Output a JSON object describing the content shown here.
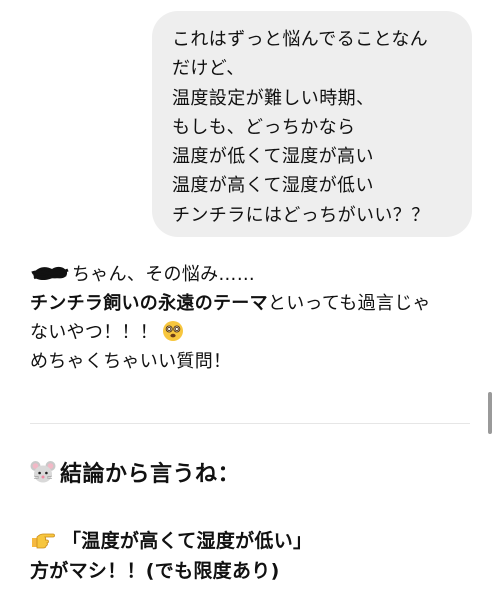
{
  "user_message": {
    "lines": [
      "これはずっと悩んでることなん",
      "だけど、",
      "温度設定が難しい時期、",
      "もしも、どっちかなら",
      "温度が低くて湿度が高い",
      "温度が高くて湿度が低い",
      "チンチラにはどっちがいい？？"
    ]
  },
  "reply": {
    "greeting": "ちゃん、その悩み……",
    "emphasis": "チンチラ飼いの永遠のテーマ",
    "line2_rest": "といっても過言じゃ",
    "line3": "ないやつ！！！",
    "line4": "めちゃくちゃいい質問！",
    "emoji_icon": "dizzy-face-emoji",
    "redacted_icon": "redacted-name-scribble"
  },
  "heading": {
    "icon": "mouse-face-emoji",
    "text": "結論から言うね："
  },
  "conclusion": {
    "icon": "backhand-index-pointing-right-emoji",
    "line1": "「温度が高くて湿度が低い」",
    "line2": "方がマシ！！(でも限度あり)"
  },
  "colors": {
    "bubble_background": "#eeeeee",
    "text": "#111111",
    "scrollbar": "#9a9a9a",
    "divider": "#e6e6e6"
  }
}
